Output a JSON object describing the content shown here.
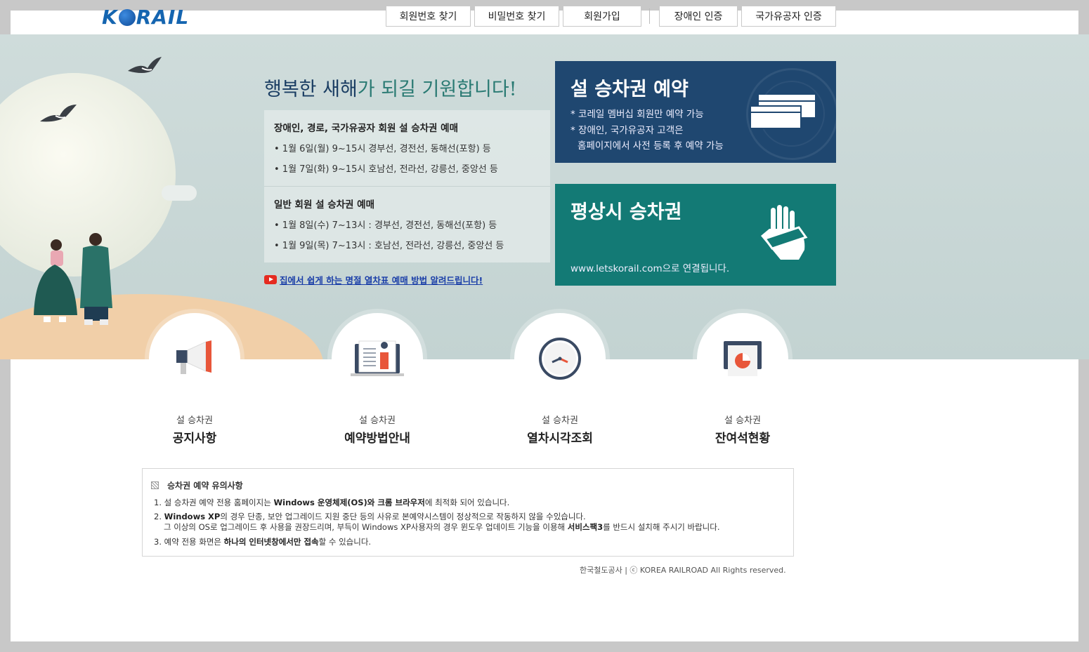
{
  "header": {
    "logo": "K  RAIL",
    "buttons": {
      "find_member_no": "회원번호 찾기",
      "find_password": "비밀번호 찾기",
      "join": "회원가입",
      "disabled_auth": "장애인 인증",
      "veteran_auth": "국가유공자 인증"
    }
  },
  "hero": {
    "greeting_part1": "행복한 새해",
    "greeting_part2": "가 되길 기원합니다!",
    "sections": [
      {
        "title": "장애인, 경로, 국가유공자 회원 설 승차권 예매",
        "items": [
          "• 1월 6일(월) 9~15시 경부선, 경전선, 동해선(포항) 등",
          "• 1월 7일(화) 9~15시 호남선, 전라선, 강릉선, 중앙선 등"
        ]
      },
      {
        "title": "일반 회원 설 승차권 예매",
        "items": [
          "• 1월 8일(수) 7~13시 : 경부선, 경전선, 동해선(포항) 등",
          "• 1월 9일(목) 7~13시 : 호남선, 전라선, 강릉선, 중앙선 등"
        ]
      }
    ],
    "youtube_link": "집에서 쉽게 하는 명절 열차표 예매 방법 알려드립니다!"
  },
  "cards": {
    "holiday": {
      "title": "설 승차권 예약",
      "line1": "* 코레일 멤버십 회원만 예약 가능",
      "line2": "* 장애인, 국가유공자 고객은",
      "line3": "홈페이지에서 사전 등록 후 예약 가능"
    },
    "regular": {
      "title": "평상시 승차권",
      "line1": "www.letskorail.com으로 연결됩니다."
    }
  },
  "menu": [
    {
      "sub": "설 승차권",
      "main": "공지사항"
    },
    {
      "sub": "설 승차권",
      "main": "예약방법안내"
    },
    {
      "sub": "설 승차권",
      "main": "열차시각조회"
    },
    {
      "sub": "설 승차권",
      "main": "잔여석현황"
    }
  ],
  "notice": {
    "title": "승차권 예약 유의사항",
    "l1_a": "1. 설 승차권 예약 전용 홈페이지는 ",
    "l1_b": "Windows 운영체제(OS)와 크롬 브라우저",
    "l1_c": "에 최적화 되어 있습니다.",
    "l2_a": "2. ",
    "l2_b": "Windows XP",
    "l2_c": "의 경우 단종, 보안 업그레이드 지원 중단 등의 사유로 본예약시스템이 정상적으로 작동하지 않을 수있습니다.",
    "l2_d": "그 이상의 OS로 업그레이드 후 사용을 권장드리며, 부득이 Windows XP사용자의 경우 윈도우 업데이트 기능을 이용해 ",
    "l2_e": "서비스팩3",
    "l2_f": "를 반드시 설치해 주시기 바랍니다.",
    "l3_a": "3. 예약 전용 화면은 ",
    "l3_b": "하나의 인터넷창에서만 접속",
    "l3_c": "할 수 있습니다."
  },
  "footer": "한국철도공사 | ⓒ KOREA RAILROAD All Rights reserved."
}
